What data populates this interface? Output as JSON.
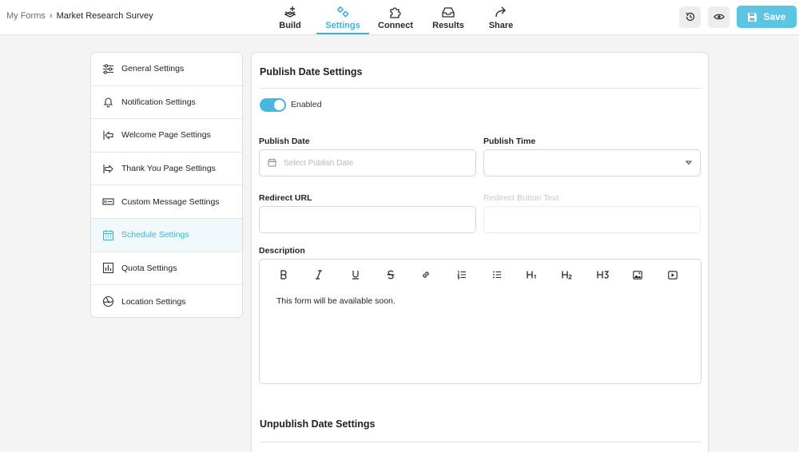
{
  "breadcrumb": {
    "parent": "My Forms",
    "separator": "›",
    "current": "Market Research Survey"
  },
  "nav_tabs": [
    {
      "label": "Build",
      "icon": "build-icon",
      "active": false
    },
    {
      "label": "Settings",
      "icon": "settings-gears-icon",
      "active": true
    },
    {
      "label": "Connect",
      "icon": "puzzle-icon",
      "active": false
    },
    {
      "label": "Results",
      "icon": "inbox-icon",
      "active": false
    },
    {
      "label": "Share",
      "icon": "share-arrow-icon",
      "active": false
    }
  ],
  "actions": {
    "history_icon": "history-icon",
    "preview_icon": "eye-icon",
    "save_label": "Save"
  },
  "sidebar": {
    "items": [
      {
        "label": "General Settings",
        "icon": "sliders-icon",
        "active": false
      },
      {
        "label": "Notification Settings",
        "icon": "bell-icon",
        "active": false
      },
      {
        "label": "Welcome Page Settings",
        "icon": "welcome-arrow-icon",
        "active": false
      },
      {
        "label": "Thank You Page Settings",
        "icon": "thankyou-arrow-icon",
        "active": false
      },
      {
        "label": "Custom Message Settings",
        "icon": "message-box-icon",
        "active": false
      },
      {
        "label": "Schedule Settings",
        "icon": "calendar-icon",
        "active": true
      },
      {
        "label": "Quota Settings",
        "icon": "bar-chart-icon",
        "active": false
      },
      {
        "label": "Location Settings",
        "icon": "globe-icon",
        "active": false
      }
    ]
  },
  "publish": {
    "title": "Publish Date Settings",
    "toggle_label": "Enabled",
    "toggle_on": true,
    "date_label": "Publish Date",
    "date_placeholder": "Select Publish Date",
    "time_label": "Publish Time",
    "time_value": "",
    "redirect_label": "Redirect URL",
    "redirect_value": "",
    "button_text_label": "Redirect Button Text",
    "button_text_value": "",
    "description_label": "Description",
    "description_text": "This form will be available soon.",
    "toolbar": [
      {
        "name": "bold",
        "glyph": "B"
      },
      {
        "name": "italic",
        "glyph": "I"
      },
      {
        "name": "underline",
        "glyph": "U"
      },
      {
        "name": "strikethrough",
        "glyph": "S"
      },
      {
        "name": "link",
        "glyph": "link"
      },
      {
        "name": "ordered-list",
        "glyph": "ol"
      },
      {
        "name": "bullet-list",
        "glyph": "ul"
      },
      {
        "name": "heading-1",
        "glyph": "H1"
      },
      {
        "name": "heading-2",
        "glyph": "H2"
      },
      {
        "name": "heading-3",
        "glyph": "H3"
      },
      {
        "name": "image",
        "glyph": "img"
      },
      {
        "name": "video",
        "glyph": "vid"
      }
    ]
  },
  "unpublish": {
    "title": "Unpublish Date Settings"
  },
  "colors": {
    "accent": "#3fb3d8",
    "save_button": "#5ec4e4",
    "toggle": "#46b8dd"
  }
}
